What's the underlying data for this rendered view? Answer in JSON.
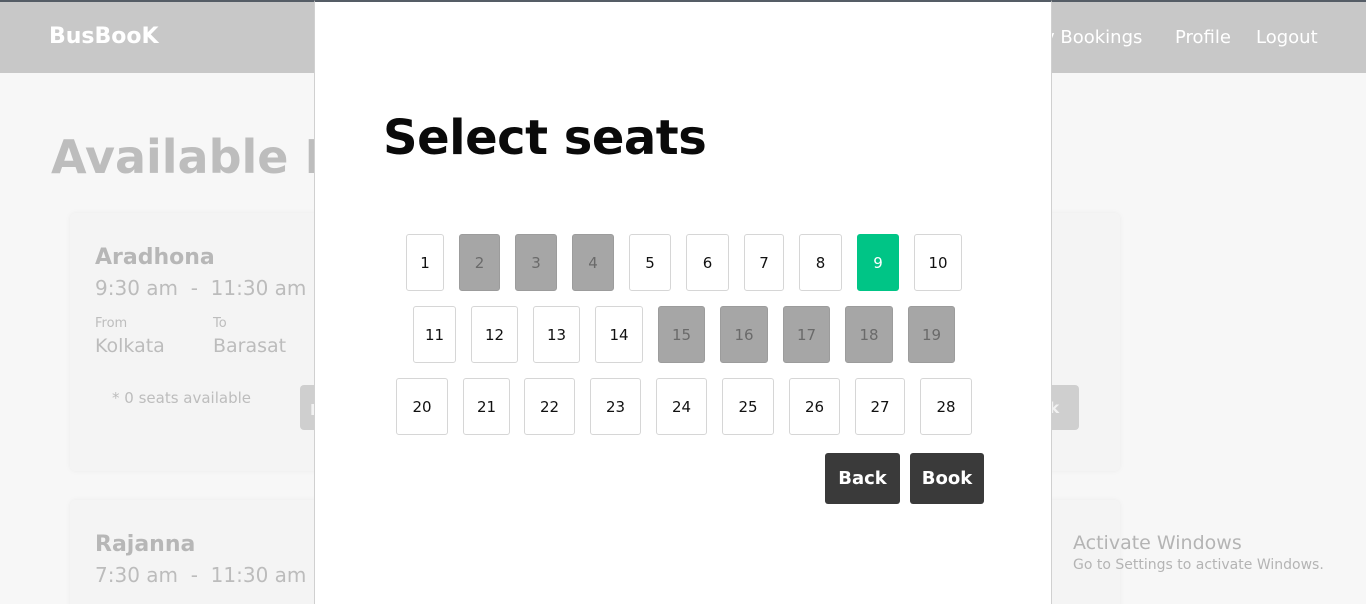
{
  "navbar": {
    "brand": "BusBooK",
    "links": [
      "y Bookings",
      "Profile",
      "Logout"
    ]
  },
  "page": {
    "title": "Available B"
  },
  "buses": [
    {
      "name": "Aradhona",
      "departure": "9:30 am",
      "separator": "-",
      "arrival": "11:30 am",
      "from_label": "From",
      "from": "Kolkata",
      "to_label": "To",
      "to": "Barasat",
      "seats_available": "* 0 seats available",
      "book_left_fragment": "B",
      "book_right_fragment": "ok"
    },
    {
      "name": "Rajanna",
      "departure": "7:30 am",
      "separator": "-",
      "arrival": "11:30 am"
    }
  ],
  "modal": {
    "title": "Select seats",
    "seats": [
      {
        "number": "1",
        "state": "available"
      },
      {
        "number": "2",
        "state": "booked"
      },
      {
        "number": "3",
        "state": "booked"
      },
      {
        "number": "4",
        "state": "booked"
      },
      {
        "number": "5",
        "state": "available"
      },
      {
        "number": "6",
        "state": "available"
      },
      {
        "number": "7",
        "state": "available"
      },
      {
        "number": "8",
        "state": "available"
      },
      {
        "number": "9",
        "state": "selected"
      },
      {
        "number": "10",
        "state": "available"
      },
      {
        "number": "11",
        "state": "available"
      },
      {
        "number": "12",
        "state": "available"
      },
      {
        "number": "13",
        "state": "available"
      },
      {
        "number": "14",
        "state": "available"
      },
      {
        "number": "15",
        "state": "booked"
      },
      {
        "number": "16",
        "state": "booked"
      },
      {
        "number": "17",
        "state": "booked"
      },
      {
        "number": "18",
        "state": "booked"
      },
      {
        "number": "19",
        "state": "booked"
      },
      {
        "number": "20",
        "state": "available"
      },
      {
        "number": "21",
        "state": "available"
      },
      {
        "number": "22",
        "state": "available"
      },
      {
        "number": "23",
        "state": "available"
      },
      {
        "number": "24",
        "state": "available"
      },
      {
        "number": "25",
        "state": "available"
      },
      {
        "number": "26",
        "state": "available"
      },
      {
        "number": "27",
        "state": "available"
      },
      {
        "number": "28",
        "state": "available"
      }
    ],
    "back_label": "Back",
    "book_label": "Book"
  },
  "watermark": {
    "line1": "Activate Windows",
    "line2": "Go to Settings to activate Windows."
  },
  "colors": {
    "selected": "#00c586",
    "booked": "#a6a6a6",
    "button": "#3a3a3a"
  }
}
